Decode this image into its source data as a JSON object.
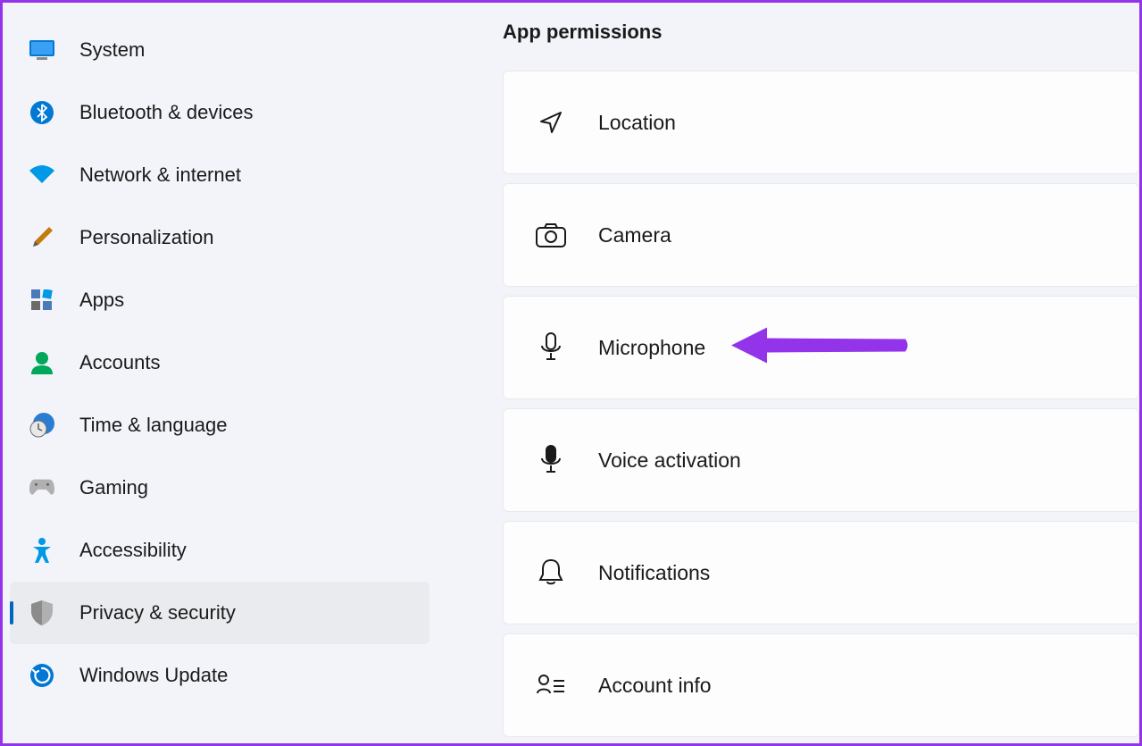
{
  "sidebar": {
    "items": [
      {
        "label": "System",
        "icon": "system"
      },
      {
        "label": "Bluetooth & devices",
        "icon": "bluetooth"
      },
      {
        "label": "Network & internet",
        "icon": "network"
      },
      {
        "label": "Personalization",
        "icon": "personalization"
      },
      {
        "label": "Apps",
        "icon": "apps"
      },
      {
        "label": "Accounts",
        "icon": "accounts"
      },
      {
        "label": "Time & language",
        "icon": "time"
      },
      {
        "label": "Gaming",
        "icon": "gaming"
      },
      {
        "label": "Accessibility",
        "icon": "accessibility"
      },
      {
        "label": "Privacy & security",
        "icon": "privacy",
        "active": true
      },
      {
        "label": "Windows Update",
        "icon": "update"
      }
    ]
  },
  "main": {
    "section_title": "App permissions",
    "permissions": [
      {
        "label": "Location",
        "icon": "location"
      },
      {
        "label": "Camera",
        "icon": "camera"
      },
      {
        "label": "Microphone",
        "icon": "microphone",
        "highlighted": true
      },
      {
        "label": "Voice activation",
        "icon": "voice"
      },
      {
        "label": "Notifications",
        "icon": "notifications"
      },
      {
        "label": "Account info",
        "icon": "accountinfo"
      }
    ]
  },
  "annotation": {
    "color": "#9333ea"
  }
}
